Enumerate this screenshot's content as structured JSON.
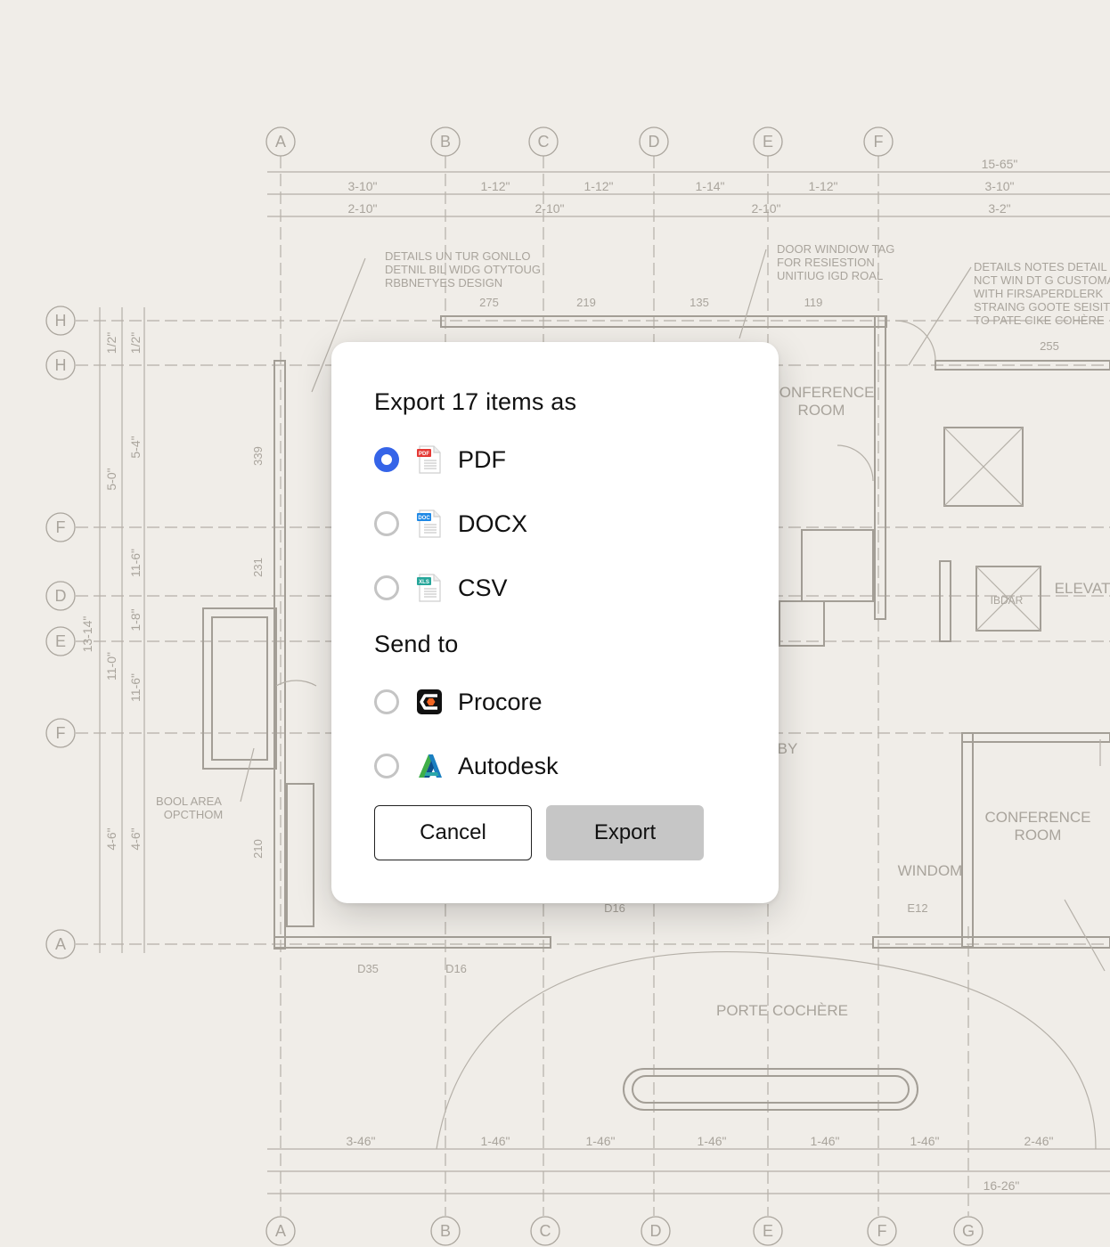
{
  "export_dialog": {
    "title": "Export 17 items as",
    "formats": [
      {
        "label": "PDF",
        "icon": "pdf-file-icon",
        "badge": "PDF",
        "badge_color": "#e53935",
        "selected": true
      },
      {
        "label": "DOCX",
        "icon": "docx-file-icon",
        "badge": "DOC",
        "badge_color": "#1e88e5",
        "selected": false
      },
      {
        "label": "CSV",
        "icon": "csv-file-icon",
        "badge": "XLS",
        "badge_color": "#26a69a",
        "selected": false
      }
    ],
    "send_to_title": "Send to",
    "destinations": [
      {
        "label": "Procore",
        "icon": "procore-logo-icon",
        "selected": false
      },
      {
        "label": "Autodesk",
        "icon": "autodesk-logo-icon",
        "selected": false
      }
    ],
    "cancel_label": "Cancel",
    "export_label": "Export"
  },
  "colors": {
    "accent": "#3564e8",
    "export_button_disabled": "#c6c6c6",
    "background": "#f0ede8"
  },
  "background_drawing": {
    "grid_labels_top": [
      "A",
      "B",
      "C",
      "D",
      "E",
      "F"
    ],
    "grid_labels_bottom": [
      "A",
      "B",
      "C",
      "D",
      "E",
      "F",
      "G"
    ],
    "grid_labels_left": [
      "H",
      "H",
      "F",
      "D",
      "E",
      "F",
      "A"
    ],
    "top_dims_row1": [
      "3-10\"",
      "1-12\"",
      "1-12\"",
      "1-14\"",
      "1-12\"",
      "3-10\""
    ],
    "top_dims_row2": [
      "2-10\"",
      "2-10\"",
      "2-10\"",
      "3-2\""
    ],
    "top_dim_extra": "15-65\"",
    "left_dims": [
      "1/2\"",
      "1/2\"",
      "5-0\"",
      "5-4\"",
      "11-6\"",
      "1-8\"",
      "11-6\"",
      "11-0\"",
      "13-14\"",
      "4-6\"",
      "4-6\""
    ],
    "bottom_dims": [
      "3-46\"",
      "1-46\"",
      "1-46\"",
      "1-46\"",
      "1-46\"",
      "1-46\"",
      "2-46\""
    ],
    "bottom_dim_extra": "16-26\"",
    "note_1": [
      "DETAILS UN TUR GONLLO",
      "DETNIL BIL WIDG OTYTOUG",
      "RBBNETYES DESIGN"
    ],
    "note_2": [
      "DOOR WINDIOW TAG",
      "FOR RESIESTION",
      "UNITIUG IGD ROAL"
    ],
    "note_3": [
      "DETAILS NOTES DETAIL",
      "NCT WIN DT G CUSTOMAR",
      "WITH FIRSAPERDLERK",
      "STRAING GOOTE SEISIT",
      "TO PATE CIKE COHÈRE"
    ],
    "tags": [
      "275",
      "219",
      "135",
      "119",
      "255",
      "339",
      "231",
      "210",
      "D35",
      "D16",
      "D16",
      "E12"
    ],
    "room_conference_1": [
      "CONFERENCE",
      "ROOM"
    ],
    "room_conference_2": [
      "CONFERENCE",
      "ROOM"
    ],
    "room_elevator": "ELEVAT",
    "room_window": "WINDOM",
    "room_lobby": "BY",
    "room_pool": [
      "BOOL AREA",
      "OPCTHOM"
    ],
    "room_porte_cochere": "PORTE COCHÈRE",
    "stair_tag": "IBDAR"
  }
}
